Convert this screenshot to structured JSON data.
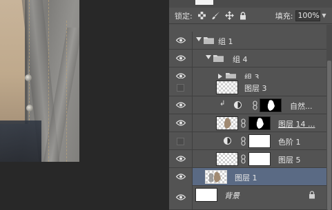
{
  "panel": {
    "lock_label": "锁定:",
    "fill_label": "填充:",
    "fill_value": "100%"
  },
  "layers": [
    {
      "name": "组 1",
      "kind": "group",
      "visible": true,
      "expanded": true,
      "indent": 0
    },
    {
      "name": "组 4",
      "kind": "group",
      "visible": true,
      "expanded": true,
      "indent": 1
    },
    {
      "name": "组 3",
      "kind": "group",
      "visible": true,
      "expanded": false,
      "indent": 2
    },
    {
      "name": "图层 3",
      "kind": "pixel",
      "visible": false
    },
    {
      "name": "自然...",
      "kind": "adjustment",
      "visible": true,
      "clipped": true
    },
    {
      "name": "图层 14 ...",
      "kind": "pixel-mask",
      "visible": true
    },
    {
      "name": "色阶 1",
      "kind": "adjustment",
      "visible": false
    },
    {
      "name": "图层 5",
      "kind": "pixel-mask",
      "visible": true
    },
    {
      "name": "图层 1",
      "kind": "pixel",
      "visible": true,
      "selected": true
    },
    {
      "name": "背景",
      "kind": "background",
      "visible": true,
      "locked": true
    }
  ],
  "icons": [
    "eye-icon",
    "folder-icon",
    "lock-icon",
    "link-icon",
    "brush-icon",
    "move-icon",
    "checker-icon"
  ],
  "colors": {
    "panel": "#535353",
    "selected": "#5a6a84",
    "canvas": "#282828"
  }
}
